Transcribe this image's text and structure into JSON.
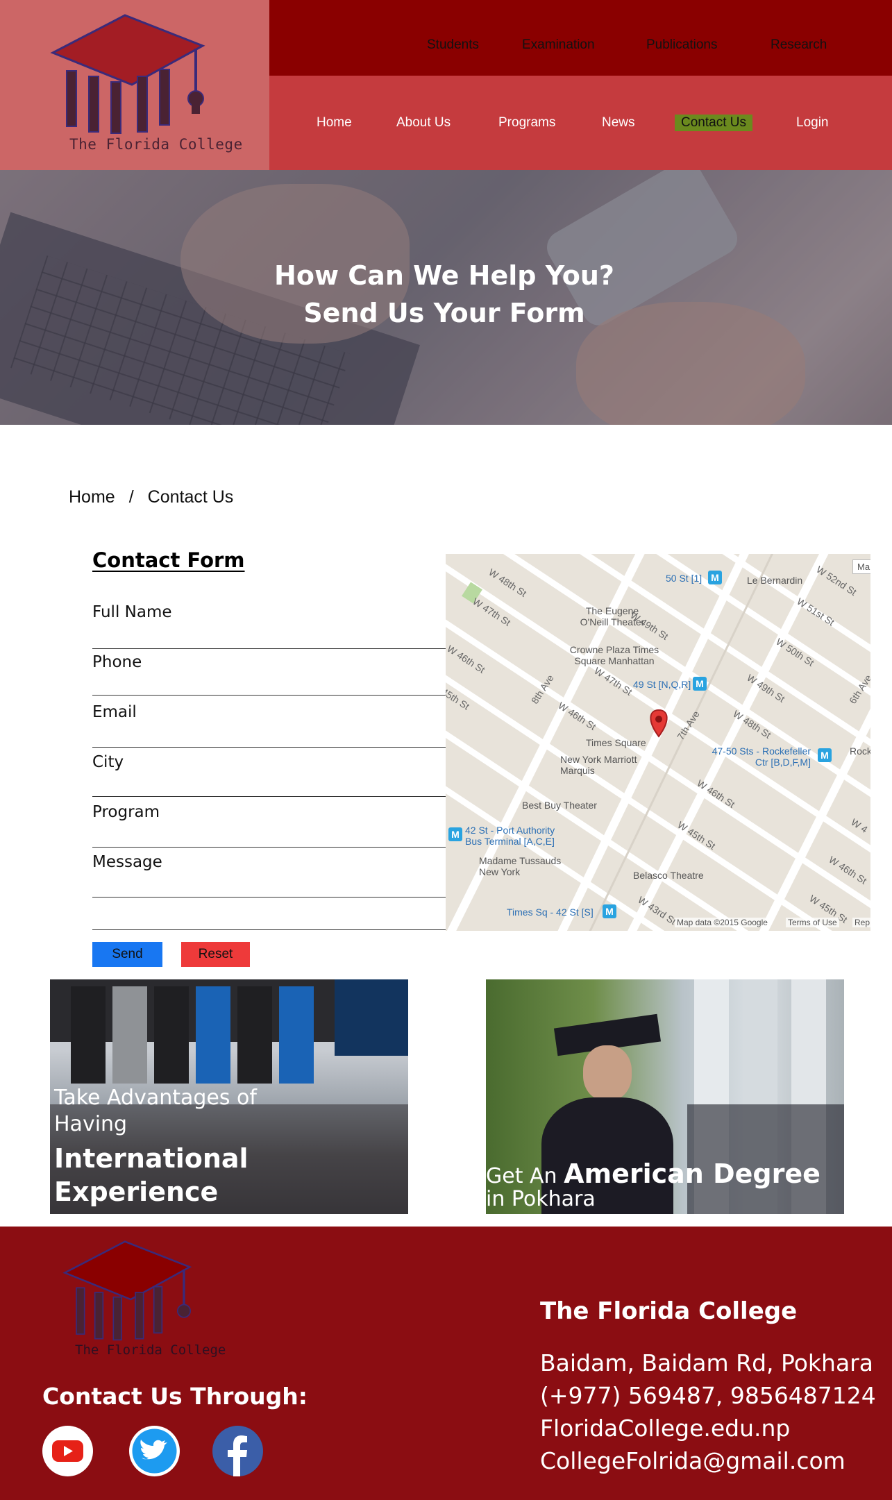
{
  "brand": {
    "logo_text": "The Florida College",
    "colors": {
      "top_nav": "#8a0000",
      "main_nav": "#c53b3e",
      "logo_bg": "#cc6666",
      "active_tab": "#6b8a1e",
      "footer": "#8b0d12",
      "send": "#1877f2",
      "reset": "#ee3a3a"
    }
  },
  "top_nav": {
    "items": [
      "Students",
      "Examination",
      "Publications",
      "Research"
    ]
  },
  "main_nav": {
    "items": [
      "Home",
      "About Us",
      "Programs",
      "News",
      "Contact Us",
      "Login"
    ],
    "active": "Contact Us"
  },
  "hero": {
    "line1": "How Can We Help You?",
    "line2": "Send Us Your Form"
  },
  "breadcrumb": {
    "home": "Home",
    "separator": "/",
    "current": "Contact Us"
  },
  "form": {
    "title": "Contact Form",
    "fields": [
      "Full Name",
      "Phone",
      "Email",
      "City",
      "Program",
      "Message"
    ],
    "send_label": "Send",
    "reset_label": "Reset"
  },
  "map": {
    "streets": [
      "W 48th St",
      "W 47th St",
      "W 46th St",
      "45th St",
      "W 49th St",
      "W 52nd St",
      "W 51st St",
      "W 50th St",
      "W 49th St",
      "W 48th St",
      "W 46th St",
      "W 45th St",
      "W 43rd St",
      "W 45th St",
      "W 46th St",
      "W 4"
    ],
    "avenues": [
      "8th Ave",
      "7th Ave",
      "6th Ave"
    ],
    "places": [
      "The Eugene O'Neill Theater",
      "Crowne Plaza Times Square Manhattan",
      "Times Square",
      "New York Marriott Marquis",
      "Best Buy Theater",
      "Madame Tussauds New York",
      "Belasco Theatre",
      "Le Bernardin",
      "Rock"
    ],
    "stations": [
      "50 St [1]",
      "49 St [N,Q,R]",
      "47-50 Sts - Rockefeller Ctr [B,D,F,M]",
      "42 St - Port Authority Bus Terminal [A,C,E]",
      "Times Sq - 42 St [S]"
    ],
    "credit": "Map data ©2015 Google",
    "terms": "Terms of Use",
    "report": "Rep",
    "map_type_button": "Ma"
  },
  "promos": [
    {
      "small": [
        "Take Advantages of",
        "Having"
      ],
      "large": [
        "International",
        "Experience"
      ]
    },
    {
      "small_before": "Get An",
      "large": "American Degree",
      "small_after": "in Pokhara"
    }
  ],
  "footer": {
    "logo_text": "The Florida College",
    "contact_through": "Contact Us Through:",
    "social": [
      "youtube-icon",
      "twitter-icon",
      "facebook-icon"
    ],
    "college_name": "The Florida College",
    "address": "Baidam, Baidam Rd, Pokhara",
    "phone": "(+977) 569487, 9856487124",
    "website": "FloridaCollege.edu.np",
    "email": "CollegeFolrida@gmail.com"
  }
}
